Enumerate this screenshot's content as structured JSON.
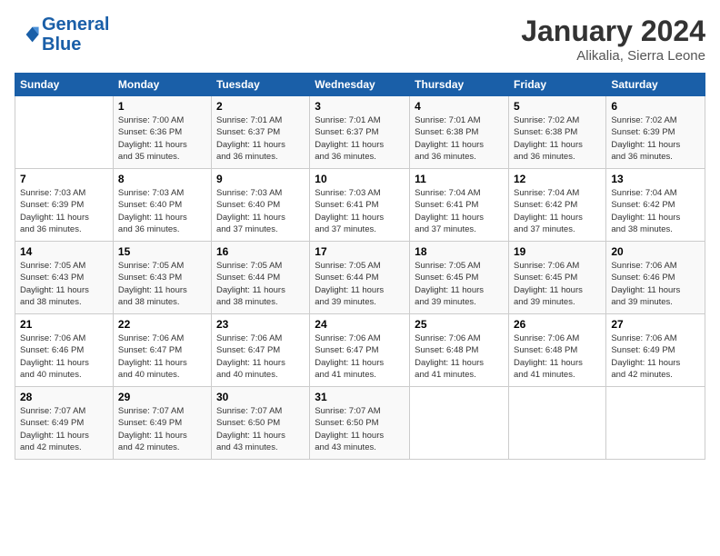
{
  "header": {
    "logo_general": "General",
    "logo_blue": "Blue",
    "title": "January 2024",
    "subtitle": "Alikalia, Sierra Leone"
  },
  "columns": [
    "Sunday",
    "Monday",
    "Tuesday",
    "Wednesday",
    "Thursday",
    "Friday",
    "Saturday"
  ],
  "weeks": [
    [
      {
        "day": "",
        "detail": ""
      },
      {
        "day": "1",
        "detail": "Sunrise: 7:00 AM\nSunset: 6:36 PM\nDaylight: 11 hours\nand 35 minutes."
      },
      {
        "day": "2",
        "detail": "Sunrise: 7:01 AM\nSunset: 6:37 PM\nDaylight: 11 hours\nand 36 minutes."
      },
      {
        "day": "3",
        "detail": "Sunrise: 7:01 AM\nSunset: 6:37 PM\nDaylight: 11 hours\nand 36 minutes."
      },
      {
        "day": "4",
        "detail": "Sunrise: 7:01 AM\nSunset: 6:38 PM\nDaylight: 11 hours\nand 36 minutes."
      },
      {
        "day": "5",
        "detail": "Sunrise: 7:02 AM\nSunset: 6:38 PM\nDaylight: 11 hours\nand 36 minutes."
      },
      {
        "day": "6",
        "detail": "Sunrise: 7:02 AM\nSunset: 6:39 PM\nDaylight: 11 hours\nand 36 minutes."
      }
    ],
    [
      {
        "day": "7",
        "detail": "Sunrise: 7:03 AM\nSunset: 6:39 PM\nDaylight: 11 hours\nand 36 minutes."
      },
      {
        "day": "8",
        "detail": "Sunrise: 7:03 AM\nSunset: 6:40 PM\nDaylight: 11 hours\nand 36 minutes."
      },
      {
        "day": "9",
        "detail": "Sunrise: 7:03 AM\nSunset: 6:40 PM\nDaylight: 11 hours\nand 37 minutes."
      },
      {
        "day": "10",
        "detail": "Sunrise: 7:03 AM\nSunset: 6:41 PM\nDaylight: 11 hours\nand 37 minutes."
      },
      {
        "day": "11",
        "detail": "Sunrise: 7:04 AM\nSunset: 6:41 PM\nDaylight: 11 hours\nand 37 minutes."
      },
      {
        "day": "12",
        "detail": "Sunrise: 7:04 AM\nSunset: 6:42 PM\nDaylight: 11 hours\nand 37 minutes."
      },
      {
        "day": "13",
        "detail": "Sunrise: 7:04 AM\nSunset: 6:42 PM\nDaylight: 11 hours\nand 38 minutes."
      }
    ],
    [
      {
        "day": "14",
        "detail": "Sunrise: 7:05 AM\nSunset: 6:43 PM\nDaylight: 11 hours\nand 38 minutes."
      },
      {
        "day": "15",
        "detail": "Sunrise: 7:05 AM\nSunset: 6:43 PM\nDaylight: 11 hours\nand 38 minutes."
      },
      {
        "day": "16",
        "detail": "Sunrise: 7:05 AM\nSunset: 6:44 PM\nDaylight: 11 hours\nand 38 minutes."
      },
      {
        "day": "17",
        "detail": "Sunrise: 7:05 AM\nSunset: 6:44 PM\nDaylight: 11 hours\nand 39 minutes."
      },
      {
        "day": "18",
        "detail": "Sunrise: 7:05 AM\nSunset: 6:45 PM\nDaylight: 11 hours\nand 39 minutes."
      },
      {
        "day": "19",
        "detail": "Sunrise: 7:06 AM\nSunset: 6:45 PM\nDaylight: 11 hours\nand 39 minutes."
      },
      {
        "day": "20",
        "detail": "Sunrise: 7:06 AM\nSunset: 6:46 PM\nDaylight: 11 hours\nand 39 minutes."
      }
    ],
    [
      {
        "day": "21",
        "detail": "Sunrise: 7:06 AM\nSunset: 6:46 PM\nDaylight: 11 hours\nand 40 minutes."
      },
      {
        "day": "22",
        "detail": "Sunrise: 7:06 AM\nSunset: 6:47 PM\nDaylight: 11 hours\nand 40 minutes."
      },
      {
        "day": "23",
        "detail": "Sunrise: 7:06 AM\nSunset: 6:47 PM\nDaylight: 11 hours\nand 40 minutes."
      },
      {
        "day": "24",
        "detail": "Sunrise: 7:06 AM\nSunset: 6:47 PM\nDaylight: 11 hours\nand 41 minutes."
      },
      {
        "day": "25",
        "detail": "Sunrise: 7:06 AM\nSunset: 6:48 PM\nDaylight: 11 hours\nand 41 minutes."
      },
      {
        "day": "26",
        "detail": "Sunrise: 7:06 AM\nSunset: 6:48 PM\nDaylight: 11 hours\nand 41 minutes."
      },
      {
        "day": "27",
        "detail": "Sunrise: 7:06 AM\nSunset: 6:49 PM\nDaylight: 11 hours\nand 42 minutes."
      }
    ],
    [
      {
        "day": "28",
        "detail": "Sunrise: 7:07 AM\nSunset: 6:49 PM\nDaylight: 11 hours\nand 42 minutes."
      },
      {
        "day": "29",
        "detail": "Sunrise: 7:07 AM\nSunset: 6:49 PM\nDaylight: 11 hours\nand 42 minutes."
      },
      {
        "day": "30",
        "detail": "Sunrise: 7:07 AM\nSunset: 6:50 PM\nDaylight: 11 hours\nand 43 minutes."
      },
      {
        "day": "31",
        "detail": "Sunrise: 7:07 AM\nSunset: 6:50 PM\nDaylight: 11 hours\nand 43 minutes."
      },
      {
        "day": "",
        "detail": ""
      },
      {
        "day": "",
        "detail": ""
      },
      {
        "day": "",
        "detail": ""
      }
    ]
  ]
}
